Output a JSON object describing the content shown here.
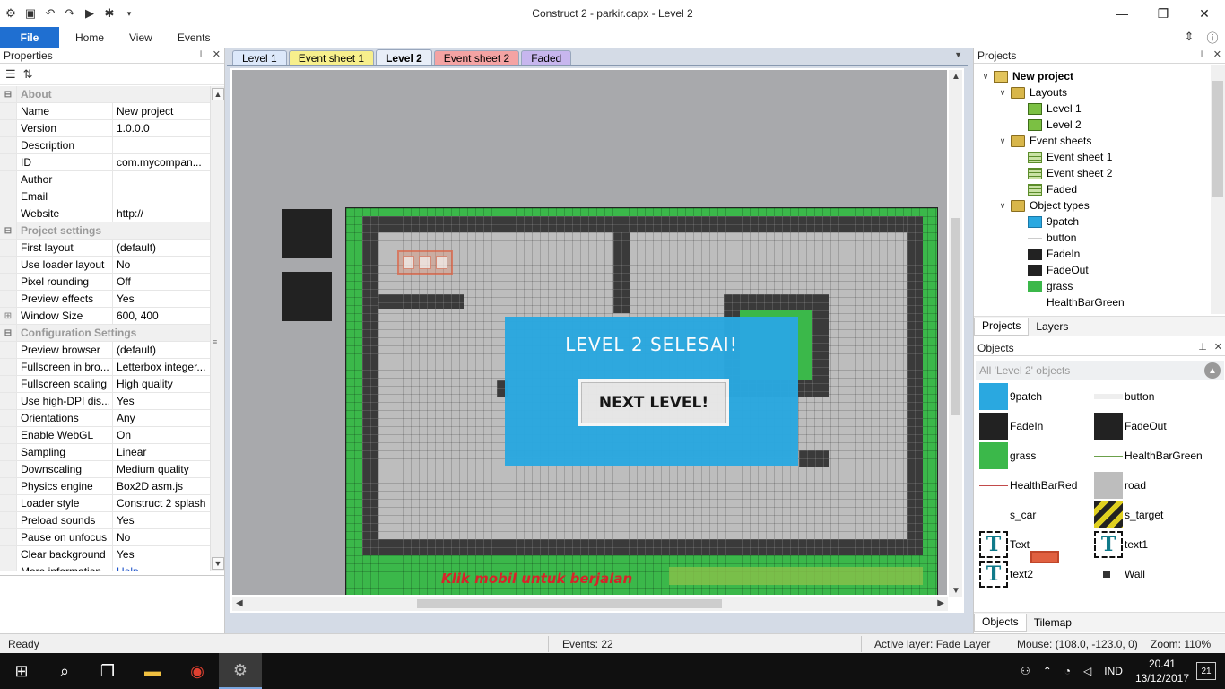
{
  "window": {
    "title": "Construct 2 - parkir.capx - Level 2"
  },
  "ribbon": {
    "tabs": [
      "File",
      "Home",
      "View",
      "Events"
    ]
  },
  "properties": {
    "title": "Properties",
    "rows": [
      {
        "type": "cat",
        "name": "About"
      },
      {
        "name": "Name",
        "value": "New project"
      },
      {
        "name": "Version",
        "value": "1.0.0.0"
      },
      {
        "name": "Description",
        "value": ""
      },
      {
        "name": "ID",
        "value": "com.mycompan..."
      },
      {
        "name": "Author",
        "value": ""
      },
      {
        "name": "Email",
        "value": ""
      },
      {
        "name": "Website",
        "value": "http://"
      },
      {
        "type": "cat",
        "name": "Project settings"
      },
      {
        "name": "First layout",
        "value": "(default)"
      },
      {
        "name": "Use loader layout",
        "value": "No"
      },
      {
        "name": "Pixel rounding",
        "value": "Off"
      },
      {
        "name": "Preview effects",
        "value": "Yes"
      },
      {
        "name": "Window Size",
        "value": "600, 400",
        "expand": true
      },
      {
        "type": "cat",
        "name": "Configuration Settings"
      },
      {
        "name": "Preview browser",
        "value": "(default)"
      },
      {
        "name": "Fullscreen in bro...",
        "value": "Letterbox integer..."
      },
      {
        "name": "Fullscreen scaling",
        "value": "High quality"
      },
      {
        "name": "Use high-DPI dis...",
        "value": "Yes"
      },
      {
        "name": "Orientations",
        "value": "Any"
      },
      {
        "name": "Enable WebGL",
        "value": "On"
      },
      {
        "name": "Sampling",
        "value": "Linear"
      },
      {
        "name": "Downscaling",
        "value": "Medium quality"
      },
      {
        "name": "Physics engine",
        "value": "Box2D asm.js"
      },
      {
        "name": "Loader style",
        "value": "Construct 2 splash"
      },
      {
        "name": "Preload sounds",
        "value": "Yes"
      },
      {
        "name": "Pause on unfocus",
        "value": "No"
      },
      {
        "name": "Clear background",
        "value": "Yes"
      },
      {
        "name": "More information",
        "value": "Help",
        "link": true
      }
    ]
  },
  "editor": {
    "tabs": [
      {
        "label": "Level 1",
        "color": "#dce8fa"
      },
      {
        "label": "Event sheet 1",
        "color": "#f7ef8c"
      },
      {
        "label": "Level 2",
        "color": "#e8eef8",
        "active": true
      },
      {
        "label": "Event sheet 2",
        "color": "#f4a3a3"
      },
      {
        "label": "Faded",
        "color": "#c7b6ee"
      }
    ],
    "overlay_title": "LEVEL 2 SELESAI!",
    "overlay_button": "NEXT LEVEL!",
    "hint_text": "Klik mobil untuk berjalan"
  },
  "projects": {
    "title": "Projects",
    "tree": [
      {
        "label": "New project",
        "level": 0,
        "icon": "folder-root",
        "expand": "v",
        "bold": true
      },
      {
        "label": "Layouts",
        "level": 1,
        "icon": "folder",
        "expand": "v"
      },
      {
        "label": "Level 1",
        "level": 2,
        "icon": "layout"
      },
      {
        "label": "Level 2",
        "level": 2,
        "icon": "layout"
      },
      {
        "label": "Event sheets",
        "level": 1,
        "icon": "folder",
        "expand": "v"
      },
      {
        "label": "Event sheet 1",
        "level": 2,
        "icon": "sheet"
      },
      {
        "label": "Event sheet 2",
        "level": 2,
        "icon": "sheet"
      },
      {
        "label": "Faded",
        "level": 2,
        "icon": "sheet"
      },
      {
        "label": "Object types",
        "level": 1,
        "icon": "folder",
        "expand": "v"
      },
      {
        "label": "9patch",
        "level": 2,
        "icon": "blue"
      },
      {
        "label": "button",
        "level": 2,
        "icon": "line"
      },
      {
        "label": "FadeIn",
        "level": 2,
        "icon": "black"
      },
      {
        "label": "FadeOut",
        "level": 2,
        "icon": "black"
      },
      {
        "label": "grass",
        "level": 2,
        "icon": "green"
      },
      {
        "label": "HealthBarGreen",
        "level": 2,
        "icon": "none"
      }
    ],
    "tabs": [
      "Projects",
      "Layers"
    ]
  },
  "objects": {
    "title": "Objects",
    "filter": "All 'Level 2' objects",
    "items": [
      {
        "label": "9patch",
        "icon": "blue"
      },
      {
        "label": "button",
        "icon": "lightgray"
      },
      {
        "label": "FadeIn",
        "icon": "black"
      },
      {
        "label": "FadeOut",
        "icon": "black"
      },
      {
        "label": "grass",
        "icon": "green"
      },
      {
        "label": "HealthBarGreen",
        "icon": "greenline"
      },
      {
        "label": "HealthBarRed",
        "icon": "redline"
      },
      {
        "label": "road",
        "icon": "gray"
      },
      {
        "label": "s_car",
        "icon": "car"
      },
      {
        "label": "s_target",
        "icon": "stripes"
      },
      {
        "label": "Text",
        "icon": "text"
      },
      {
        "label": "text1",
        "icon": "text"
      },
      {
        "label": "text2",
        "icon": "text"
      },
      {
        "label": "Wall",
        "icon": "wall"
      }
    ],
    "tabs": [
      "Objects",
      "Tilemap"
    ]
  },
  "status": {
    "ready": "Ready",
    "events": "Events: 22",
    "layer": "Active layer: Fade Layer",
    "mouse": "Mouse: (108.0, -123.0, 0)",
    "zoom": "Zoom: 110%"
  },
  "taskbar": {
    "lang": "IND",
    "time": "20.41",
    "date": "13/12/2017",
    "notifications": "21"
  }
}
